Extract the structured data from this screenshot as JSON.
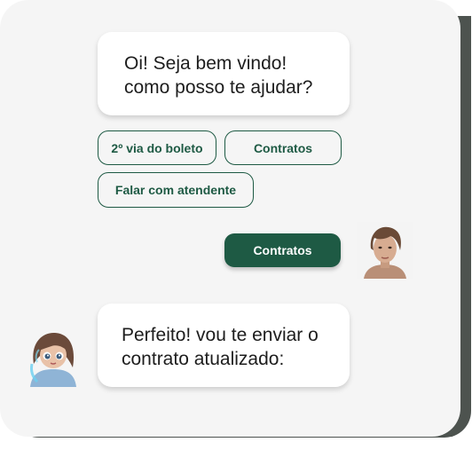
{
  "chat": {
    "bot_greeting": {
      "line1": "Oi! Seja bem vindo!",
      "line2": "como posso te ajudar?"
    },
    "quick_replies": [
      {
        "label": "2º via do boleto"
      },
      {
        "label": "Contratos"
      },
      {
        "label": "Falar com atendente"
      }
    ],
    "user_message": {
      "label": "Contratos"
    },
    "bot_reply": {
      "line1": "Perfeito! vou te enviar o",
      "line2": "contrato atualizado:"
    }
  },
  "colors": {
    "brand_green": "#1e5a44",
    "card_background": "#f5f5f5",
    "card_shadow": "#4d534f",
    "bubble_background": "#ffffff",
    "text_dark": "#1d1d1d"
  },
  "icons": {
    "user_avatar": "user-avatar-photo",
    "bot_avatar": "bot-avatar-illustration"
  }
}
